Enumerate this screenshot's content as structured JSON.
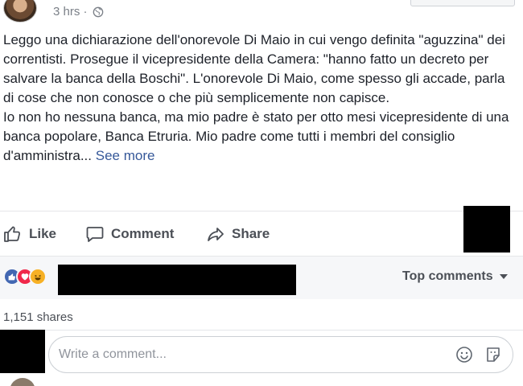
{
  "post": {
    "timestamp": "3 hrs ·",
    "privacy_icon": "globe-icon",
    "paragraphs": [
      "Leggo una dichiarazione dell'onorevole Di Maio in cui vengo definita \"aguzzina\" dei correntisti. Prosegue il vicepresidente della Camera: \"hanno fatto un decreto per salvare la banca della Boschi\". L'onorevole Di Maio, come spesso gli accade, parla di cose che non conosce o che più semplicemente non capisce.",
      "Io non ho nessuna banca, ma mio padre è stato per otto mesi vicepresidente di una banca popolare, Banca Etruria. Mio padre come tutti i membri del consiglio d'amministra..."
    ],
    "see_more": "See more"
  },
  "actions": {
    "like": "Like",
    "comment": "Comment",
    "share": "Share"
  },
  "reactions": {
    "icons": [
      "like-reaction-icon",
      "love-reaction-icon",
      "haha-reaction-icon"
    ],
    "top_comments": "Top comments"
  },
  "shares": "1,151 shares",
  "comment_box": {
    "placeholder": "Write a comment..."
  },
  "colors": {
    "link": "#365899",
    "like_blue": "#4267b2",
    "love_red": "#f0284a",
    "haha_yellow": "#f7b125"
  }
}
